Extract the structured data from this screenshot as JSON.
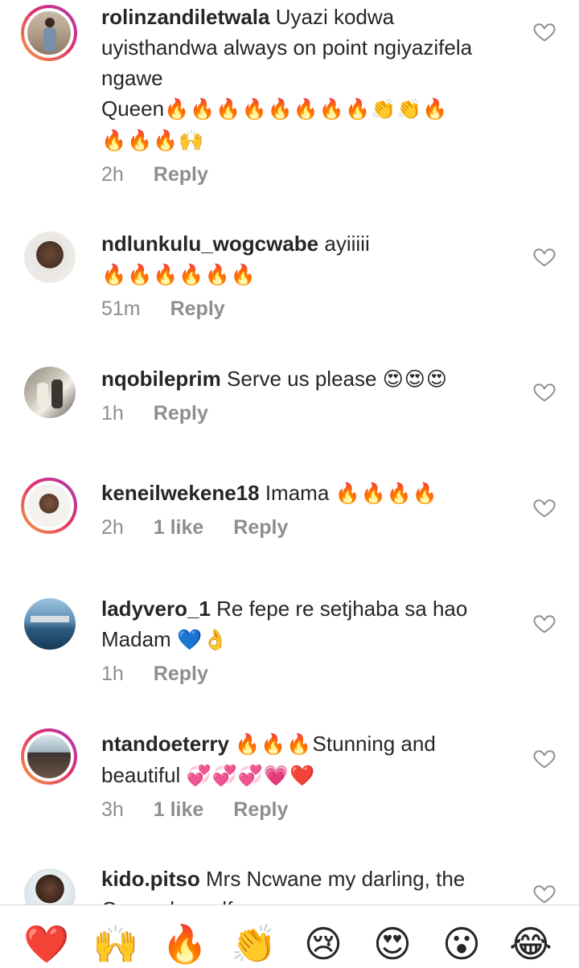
{
  "comments": [
    {
      "username": "rolinzandiletwala",
      "text": "Uyazi kodwa uyisthandwa always on point ngiyazifela ngawe",
      "text2": "Queen",
      "emoji": "🔥🔥🔥🔥🔥🔥🔥🔥👏👏🔥",
      "emoji2": "🔥🔥🔥🙌",
      "time": "2h",
      "likes": "",
      "reply": "Reply"
    },
    {
      "username": "ndlunkulu_wogcwabe",
      "text": "ayiiiii",
      "emoji": "🔥🔥🔥🔥🔥🔥",
      "time": "51m",
      "likes": "",
      "reply": "Reply"
    },
    {
      "username": "nqobileprim",
      "text": "Serve us please",
      "emoji": "😍😍😍",
      "time": "1h",
      "likes": "",
      "reply": "Reply"
    },
    {
      "username": "keneilwekene18",
      "text": "Imama",
      "emoji": "🔥🔥🔥🔥",
      "time": "2h",
      "likes": "1 like",
      "reply": "Reply"
    },
    {
      "username": "ladyvero_1",
      "text": "Re fepe re setjhaba sa hao Madam",
      "emoji": "💙👌",
      "time": "1h",
      "likes": "",
      "reply": "Reply"
    },
    {
      "username": "ntandoeterry",
      "emoji_lead": "🔥🔥🔥",
      "text": "Stunning and beautiful",
      "emoji": "💞💞💞💗❤️",
      "time": "3h",
      "likes": "1 like",
      "reply": "Reply"
    },
    {
      "username": "kido.pitso",
      "text": "Mrs Ncwane my darling, the Queen herself",
      "time": "",
      "likes": "",
      "reply": ""
    }
  ],
  "reactions": [
    "❤️",
    "🙌",
    "🔥",
    "👏",
    "😢",
    "😍",
    "😮",
    "😂"
  ],
  "colors": {
    "text": "#262626",
    "meta": "#8e8e8e",
    "story_ring_start": "#f9a03f",
    "story_ring_end": "#a73bb8"
  }
}
